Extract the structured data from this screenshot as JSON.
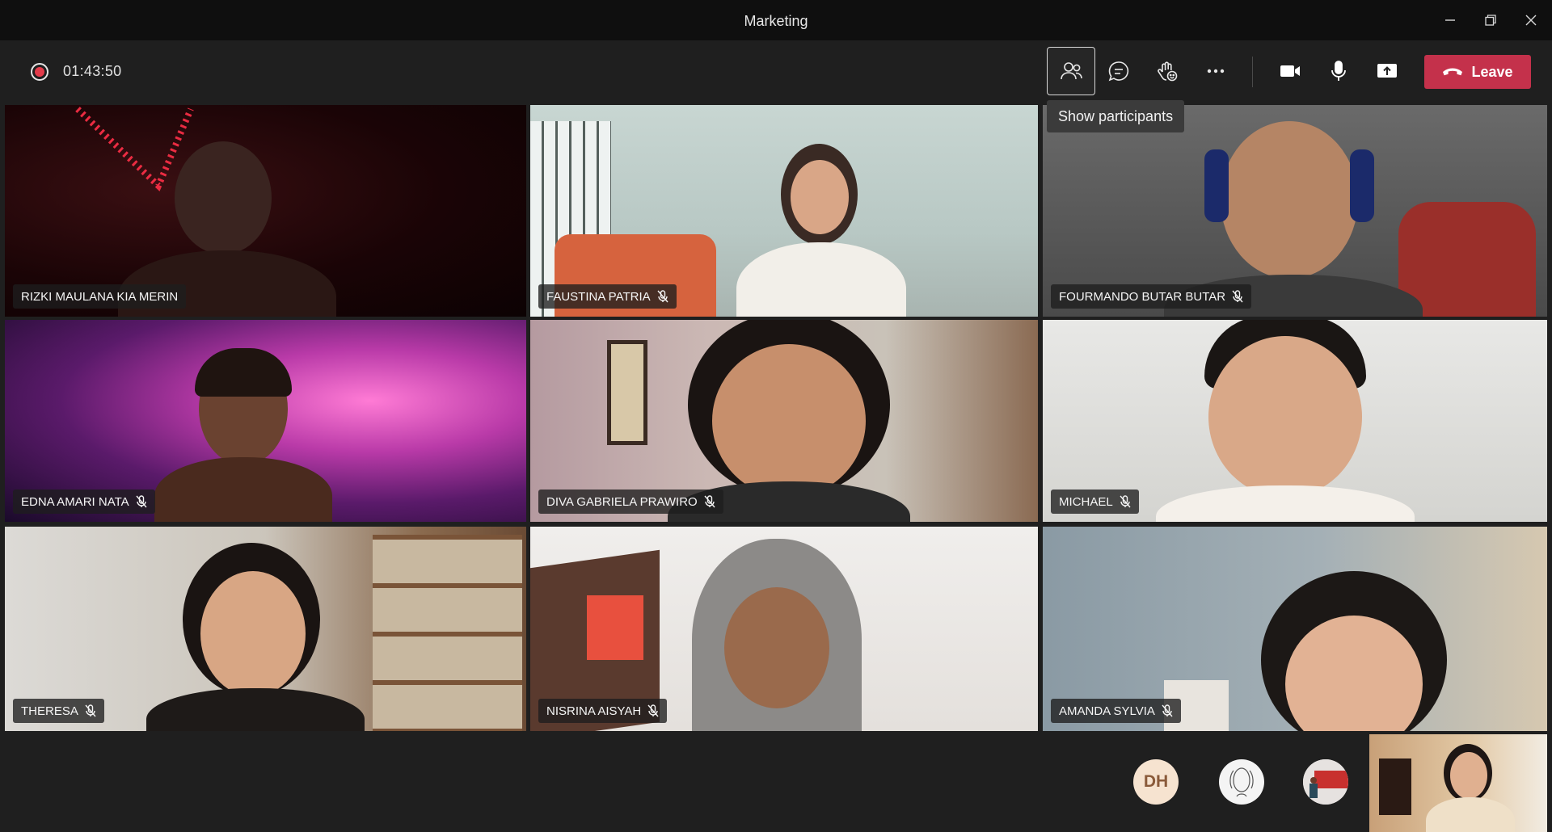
{
  "window": {
    "title": "Marketing"
  },
  "toolbar": {
    "recording_time": "01:43:50",
    "leave_label": "Leave",
    "tooltip": "Show participants",
    "buttons": [
      {
        "id": "participants",
        "icon": "participants-icon",
        "active": true
      },
      {
        "id": "chat",
        "icon": "chat-icon"
      },
      {
        "id": "reactions",
        "icon": "raise-hand-icon"
      },
      {
        "id": "more",
        "icon": "more-icon"
      },
      {
        "id": "camera",
        "icon": "camera-icon"
      },
      {
        "id": "mic",
        "icon": "microphone-icon"
      },
      {
        "id": "share",
        "icon": "share-screen-icon"
      }
    ]
  },
  "participants": [
    {
      "name": "RIZKI MAULANA KIA MERIN",
      "muted": false
    },
    {
      "name": "FAUSTINA PATRIA",
      "muted": true
    },
    {
      "name": "FOURMANDO BUTAR BUTAR",
      "muted": true
    },
    {
      "name": "EDNA AMARI NATA",
      "muted": true
    },
    {
      "name": "DIVA GABRIELA PRAWIRO",
      "muted": true
    },
    {
      "name": "MICHAEL",
      "muted": true
    },
    {
      "name": "THERESA",
      "muted": true
    },
    {
      "name": "NISRINA AISYAH",
      "muted": true
    },
    {
      "name": "AMANDA SYLVIA",
      "muted": true
    }
  ],
  "bottom": {
    "avatar_initials": "DH"
  },
  "colors": {
    "leave": "#c4314b",
    "record": "#e23b4a",
    "background": "#1f1f1f"
  }
}
